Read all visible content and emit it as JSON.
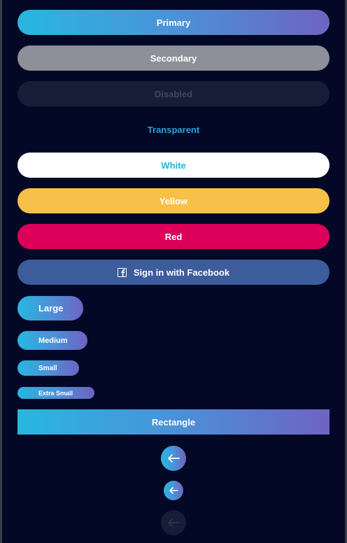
{
  "buttons": {
    "primary": "Primary",
    "secondary": "Secondary",
    "disabled": "Disabled",
    "transparent": "Transparent",
    "white": "White",
    "yellow": "Yellow",
    "red": "Red",
    "facebook": "Sign in with Facebook",
    "large": "Large",
    "medium": "Medium",
    "small": "Small",
    "extra_small": "Extra Small",
    "rectangle": "Rectangle"
  },
  "icons": {
    "facebook": "facebook-icon",
    "back_arrow": "arrow-left-icon"
  },
  "colors": {
    "background": "#020825",
    "gradient_start": "#27b7e0",
    "gradient_end": "#6e63c2",
    "secondary": "#8e9099",
    "disabled": "#161d37",
    "yellow": "#f6c049",
    "red": "#dc005b",
    "facebook": "#3c5c9b"
  }
}
